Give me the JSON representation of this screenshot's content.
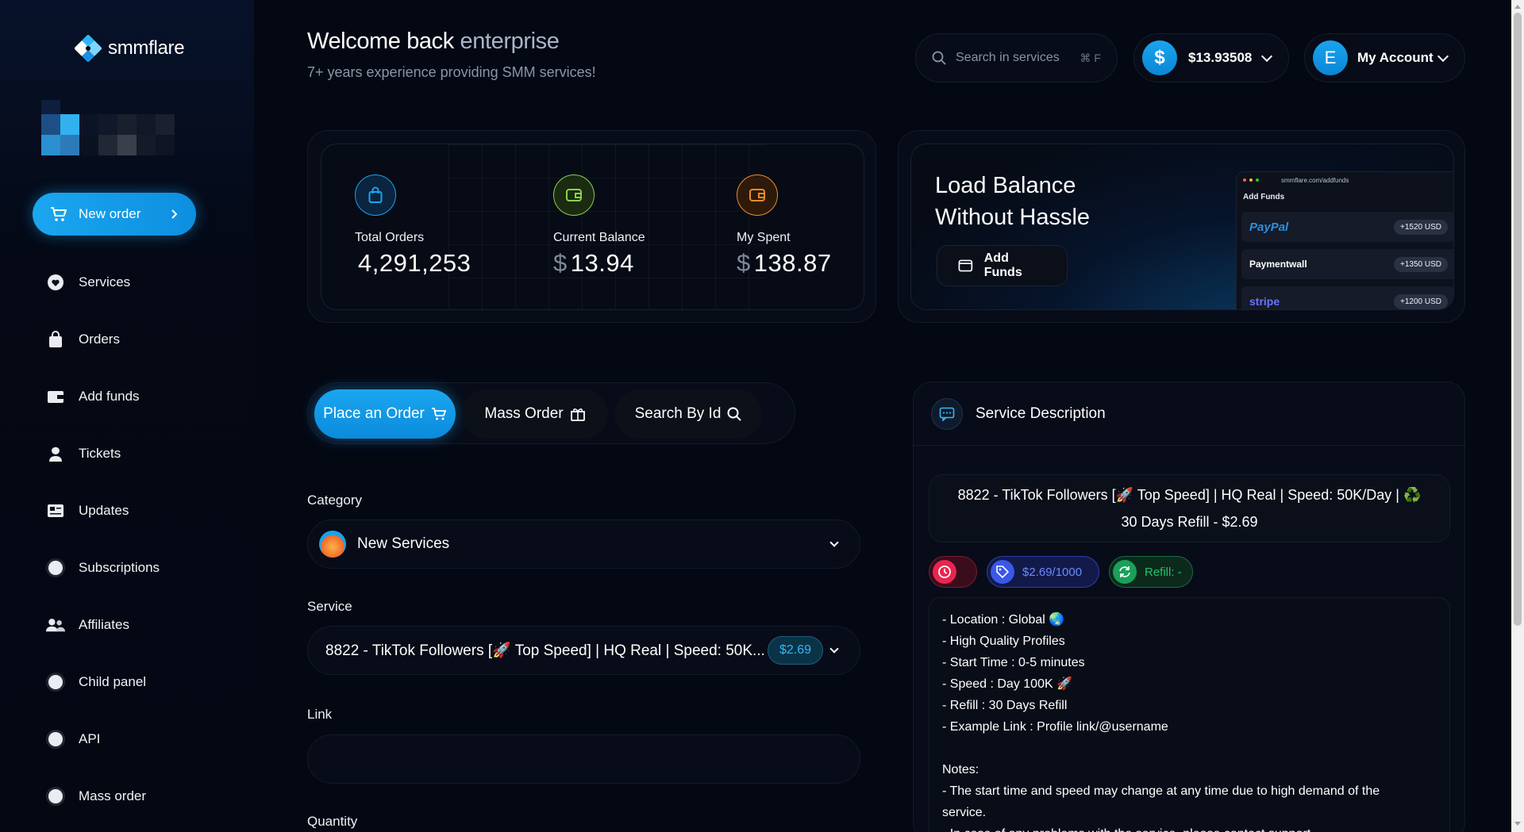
{
  "brand": {
    "name": "smmflare"
  },
  "header": {
    "welcome_prefix": "Welcome back",
    "username": "enterprise",
    "subtitle": "7+ years experience providing SMM services!",
    "search_placeholder": "Search in services",
    "search_shortcut": "⌘ F",
    "balance_symbol": "$",
    "balance": "$13.93508",
    "account_initial": "E",
    "account_label": "My Account"
  },
  "sidebar": {
    "new_order": "New order",
    "items": [
      {
        "label": "Services",
        "icon": "heart-icon"
      },
      {
        "label": "Orders",
        "icon": "shopping-bag-icon"
      },
      {
        "label": "Add funds",
        "icon": "wallet-icon"
      },
      {
        "label": "Tickets",
        "icon": "support-agent-icon"
      },
      {
        "label": "Updates",
        "icon": "newspaper-icon"
      },
      {
        "label": "Subscriptions",
        "icon": "circle-icon"
      },
      {
        "label": "Affiliates",
        "icon": "users-icon"
      },
      {
        "label": "Child panel",
        "icon": "circle-icon"
      },
      {
        "label": "API",
        "icon": "circle-icon"
      },
      {
        "label": "Mass order",
        "icon": "circle-icon"
      }
    ]
  },
  "stats": [
    {
      "label": "Total Orders",
      "value": "4,291,253",
      "currency": "",
      "color": "#1aa4ee",
      "icon": "shopping-bag-icon"
    },
    {
      "label": "Current Balance",
      "value": "13.94",
      "currency": "$",
      "color": "#8bd24a",
      "icon": "wallet-icon"
    },
    {
      "label": "My Spent",
      "value": "138.87",
      "currency": "$",
      "color": "#f08a2c",
      "icon": "wallet-icon"
    }
  ],
  "load_balance": {
    "title_line1": "Load Balance",
    "title_line2": "Without Hassle",
    "button": "Add Funds",
    "preview_url": "smmflare.com/addfunds",
    "preview_heading": "Add Funds",
    "providers": [
      {
        "name": "PayPal",
        "amount": "+1520 USD"
      },
      {
        "name": "Paymentwall",
        "amount": "+1350 USD"
      },
      {
        "name": "stripe",
        "amount": "+1200 USD"
      }
    ]
  },
  "tabs": [
    {
      "label": "Place an Order",
      "icon": "cart-icon",
      "active": true
    },
    {
      "label": "Mass Order",
      "icon": "gift-box-icon",
      "active": false
    },
    {
      "label": "Search By Id",
      "icon": "search-icon",
      "active": false
    }
  ],
  "form": {
    "category_label": "Category",
    "category_value": "New Services",
    "service_label": "Service",
    "service_value": "8822 -  TikTok Followers [🚀 Top Speed] | HQ Real | Speed: 50K...",
    "service_price": "$2.69",
    "link_label": "Link",
    "link_value": "",
    "quantity_label": "Quantity"
  },
  "description": {
    "title": "Service Description",
    "service_name_line1": "8822 - TikTok Followers [🚀 Top Speed] | HQ Real | Speed: 50K/Day | ♻️",
    "service_name_line2": "30 Days Refill - $2.69",
    "rate": "$2.69/1000",
    "refill": "Refill: -",
    "lines": [
      "- Location : Global 🌏",
      "- High Quality Profiles",
      "- Start Time : 0-5 minutes",
      "- Speed : Day 100K 🚀",
      "- Refill : 30 Days Refill",
      "- Example Link : Profile link/@username",
      "",
      "Notes:",
      "- The start time and speed may change at any time due to high demand of the",
      "service.",
      "- In case of any problems with the service, please contact support."
    ]
  }
}
